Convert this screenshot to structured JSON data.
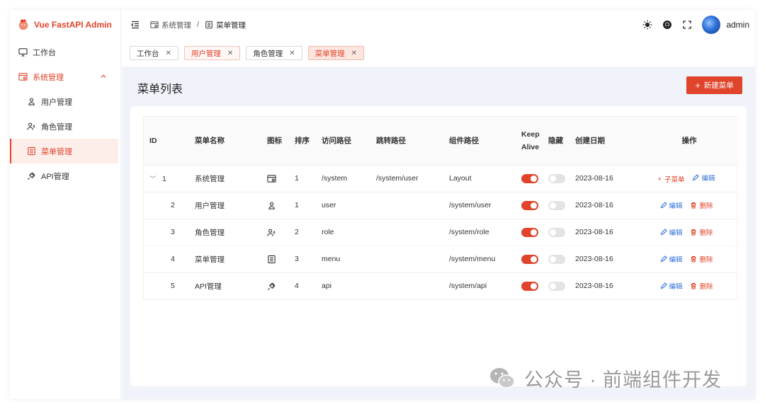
{
  "app": {
    "title": "Vue FastAPI Admin"
  },
  "sidebar": {
    "items": [
      {
        "label": "工作台",
        "icon": "monitor-icon"
      },
      {
        "label": "系统管理",
        "icon": "settings-window-icon"
      },
      {
        "label": "用户管理",
        "icon": "user-icon"
      },
      {
        "label": "角色管理",
        "icon": "user-role-icon"
      },
      {
        "label": "菜单管理",
        "icon": "menu-list-icon"
      },
      {
        "label": "API管理",
        "icon": "api-plug-icon"
      }
    ]
  },
  "header": {
    "breadcrumb": [
      "系统管理",
      "菜单管理"
    ],
    "username": "admin"
  },
  "tabs": [
    {
      "label": "工作台"
    },
    {
      "label": "用户管理"
    },
    {
      "label": "角色管理"
    },
    {
      "label": "菜单管理"
    }
  ],
  "page": {
    "title": "菜单列表",
    "new_button": "新建菜单"
  },
  "table": {
    "columns": [
      "ID",
      "菜单名称",
      "图标",
      "排序",
      "访问路径",
      "跳转路径",
      "组件路径",
      "KeepAlive",
      "隐藏",
      "创建日期",
      "操作"
    ],
    "rows": [
      {
        "id": "1",
        "name": "系统管理",
        "icon": "settings-window-icon",
        "order": "1",
        "path": "/system",
        "redirect": "/system/user",
        "component": "Layout",
        "keepalive": true,
        "hidden": false,
        "created": "2023-08-16",
        "actions": [
          "子菜单",
          "编辑"
        ]
      },
      {
        "id": "2",
        "name": "用户管理",
        "icon": "user-icon",
        "order": "1",
        "path": "user",
        "redirect": "",
        "component": "/system/user",
        "keepalive": true,
        "hidden": false,
        "created": "2023-08-16",
        "actions": [
          "编辑",
          "删除"
        ]
      },
      {
        "id": "3",
        "name": "角色管理",
        "icon": "user-role-icon",
        "order": "2",
        "path": "role",
        "redirect": "",
        "component": "/system/role",
        "keepalive": true,
        "hidden": false,
        "created": "2023-08-16",
        "actions": [
          "编辑",
          "删除"
        ]
      },
      {
        "id": "4",
        "name": "菜单管理",
        "icon": "menu-list-icon",
        "order": "3",
        "path": "menu",
        "redirect": "",
        "component": "/system/menu",
        "keepalive": true,
        "hidden": false,
        "created": "2023-08-16",
        "actions": [
          "编辑",
          "删除"
        ]
      },
      {
        "id": "5",
        "name": "API管理",
        "icon": "api-plug-icon",
        "order": "4",
        "path": "api",
        "redirect": "",
        "component": "/system/api",
        "keepalive": true,
        "hidden": false,
        "created": "2023-08-16",
        "actions": [
          "编辑",
          "删除"
        ]
      }
    ]
  },
  "watermark": {
    "text": "公众号 · 前端组件开发"
  },
  "colors": {
    "accent": "#e0442a",
    "link": "#2f6fd8",
    "content_bg": "#f0f3f9"
  }
}
